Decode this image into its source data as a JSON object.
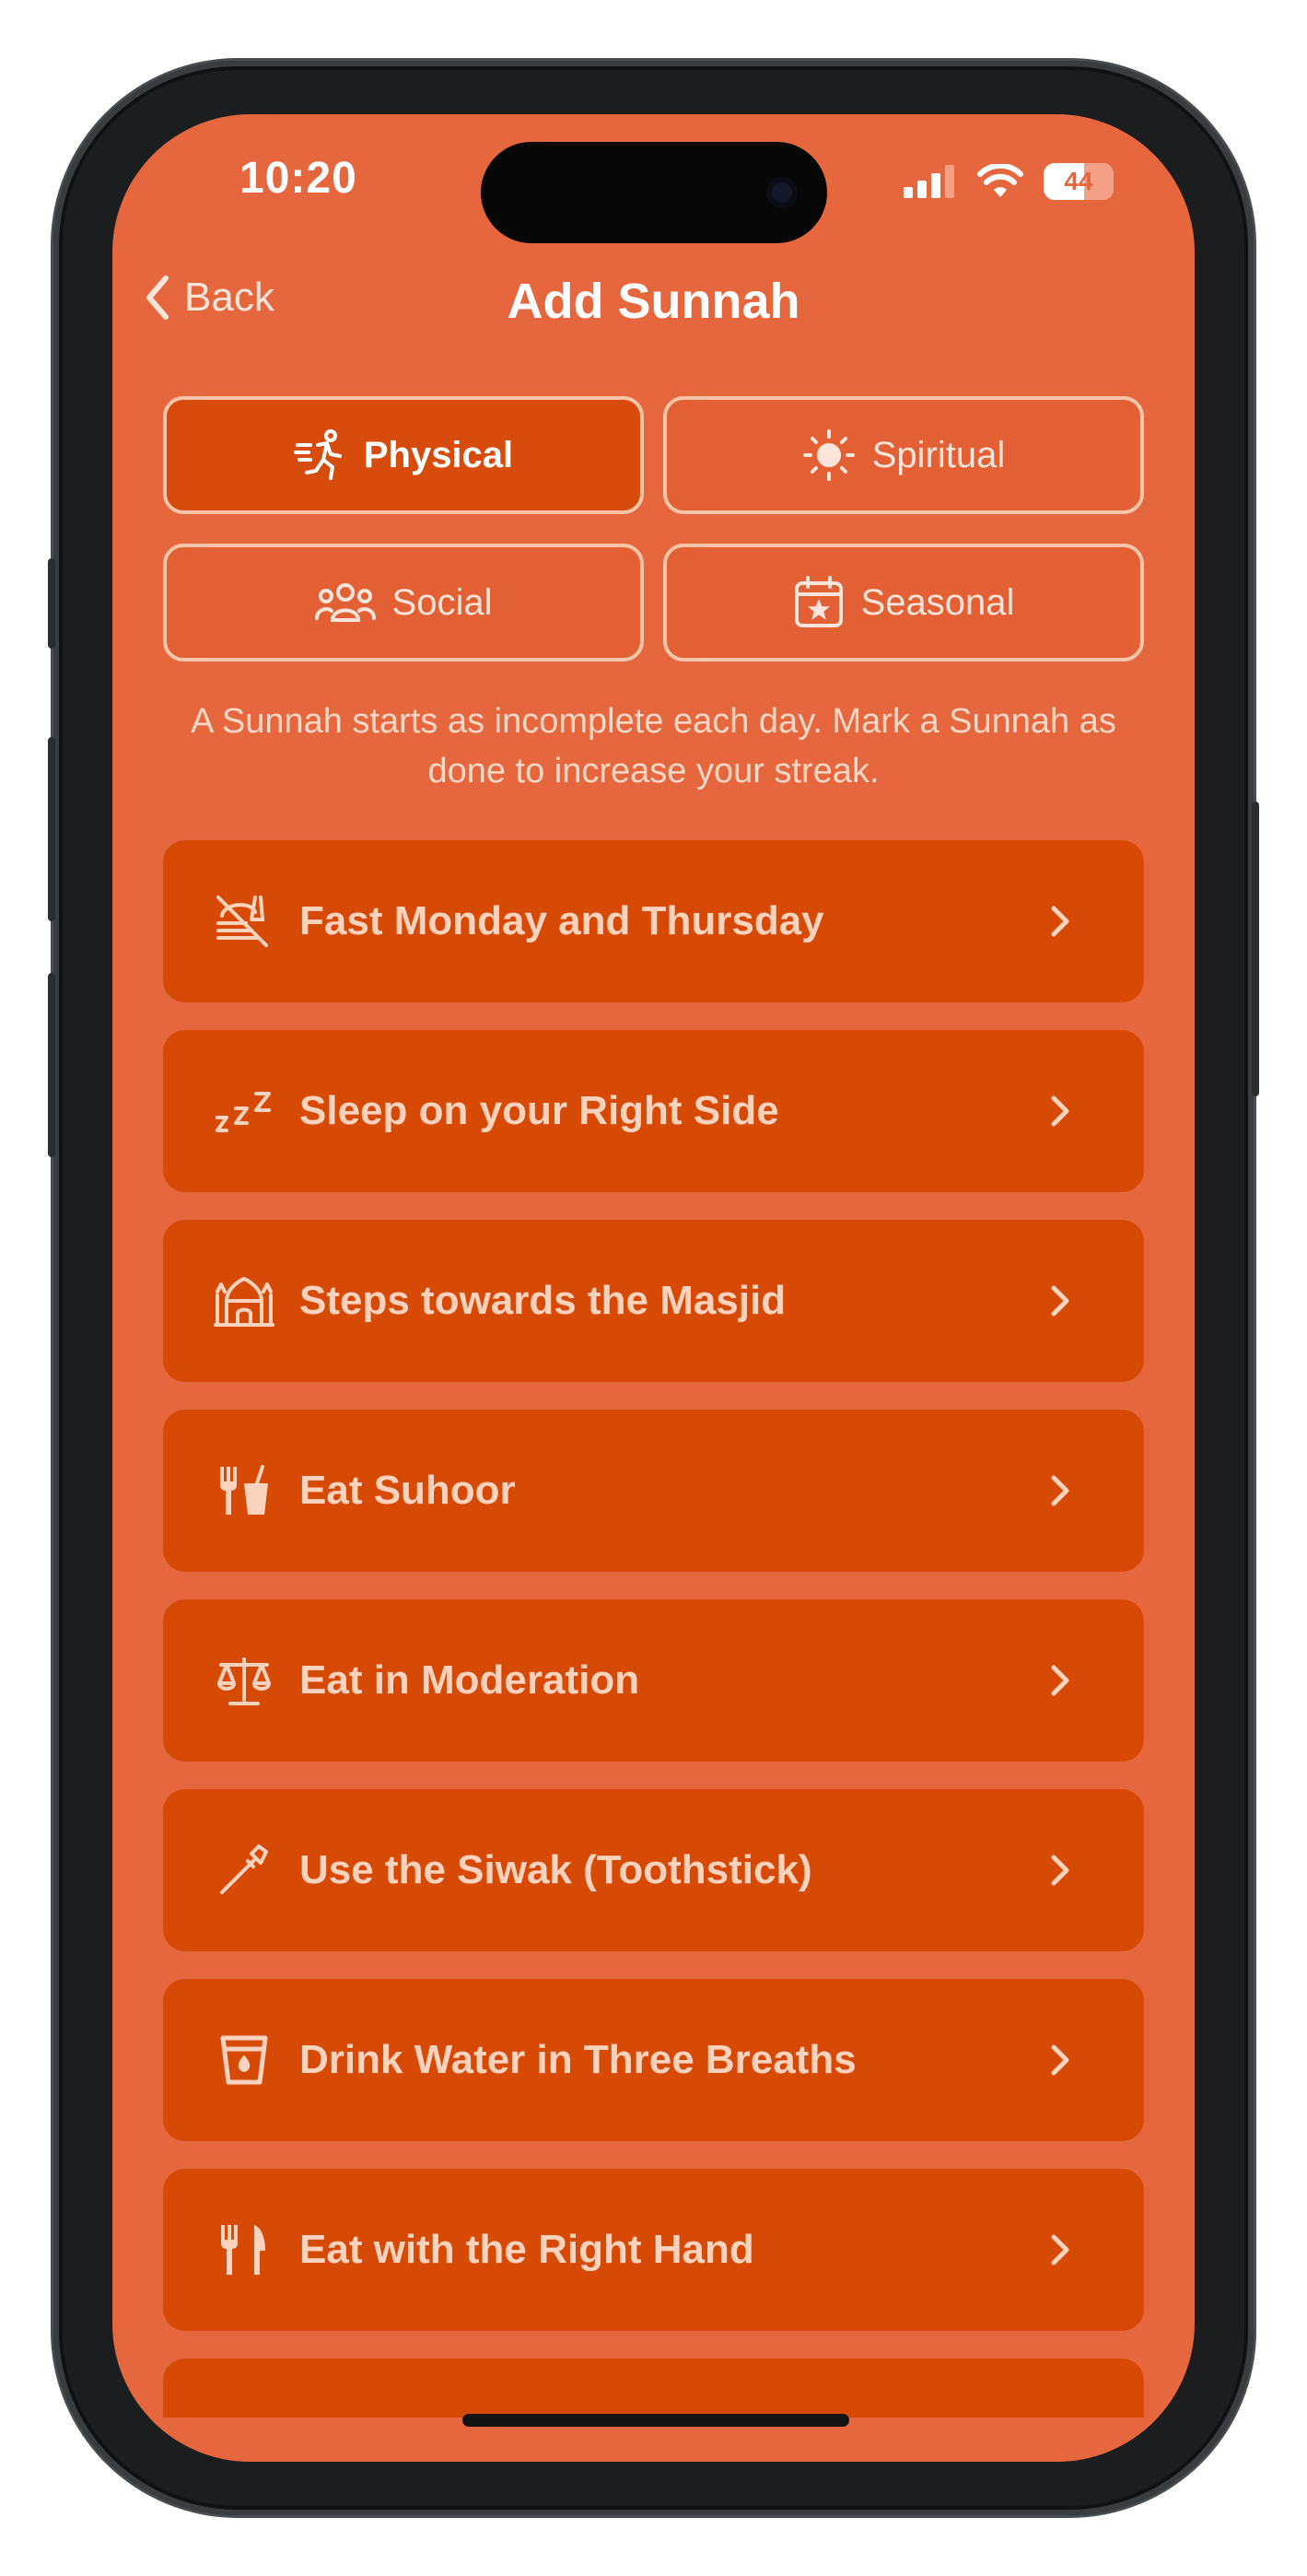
{
  "status_bar": {
    "time": "10:20",
    "battery": "44"
  },
  "nav": {
    "back_label": "Back",
    "title": "Add Sunnah"
  },
  "categories": [
    {
      "label": "Physical",
      "icon": "running-person-icon",
      "selected": true
    },
    {
      "label": "Spiritual",
      "icon": "sun-icon",
      "selected": false
    },
    {
      "label": "Social",
      "icon": "people-group-icon",
      "selected": false
    },
    {
      "label": "Seasonal",
      "icon": "calendar-star-icon",
      "selected": false
    }
  ],
  "note": "A Sunnah starts as incomplete each day. Mark a Sunnah as done to increase your streak.",
  "sunnahs": [
    {
      "label": "Fast Monday and Thursday",
      "icon": "no-food-icon"
    },
    {
      "label": "Sleep on your Right Side",
      "icon": "sleep-zzz-icon"
    },
    {
      "label": "Steps towards the Masjid",
      "icon": "mosque-icon"
    },
    {
      "label": "Eat Suhoor",
      "icon": "fork-cup-icon"
    },
    {
      "label": "Eat in Moderation",
      "icon": "balance-scale-icon"
    },
    {
      "label": "Use the Siwak (Toothstick)",
      "icon": "toothstick-icon"
    },
    {
      "label": "Drink Water in Three Breaths",
      "icon": "water-glass-icon"
    },
    {
      "label": "Eat with the Right Hand",
      "icon": "fork-knife-icon"
    }
  ],
  "colors": {
    "background": "#e6663e",
    "card": "#d64a06",
    "selected_tab": "#d74b0c",
    "text_muted": "#fbd2bd"
  }
}
